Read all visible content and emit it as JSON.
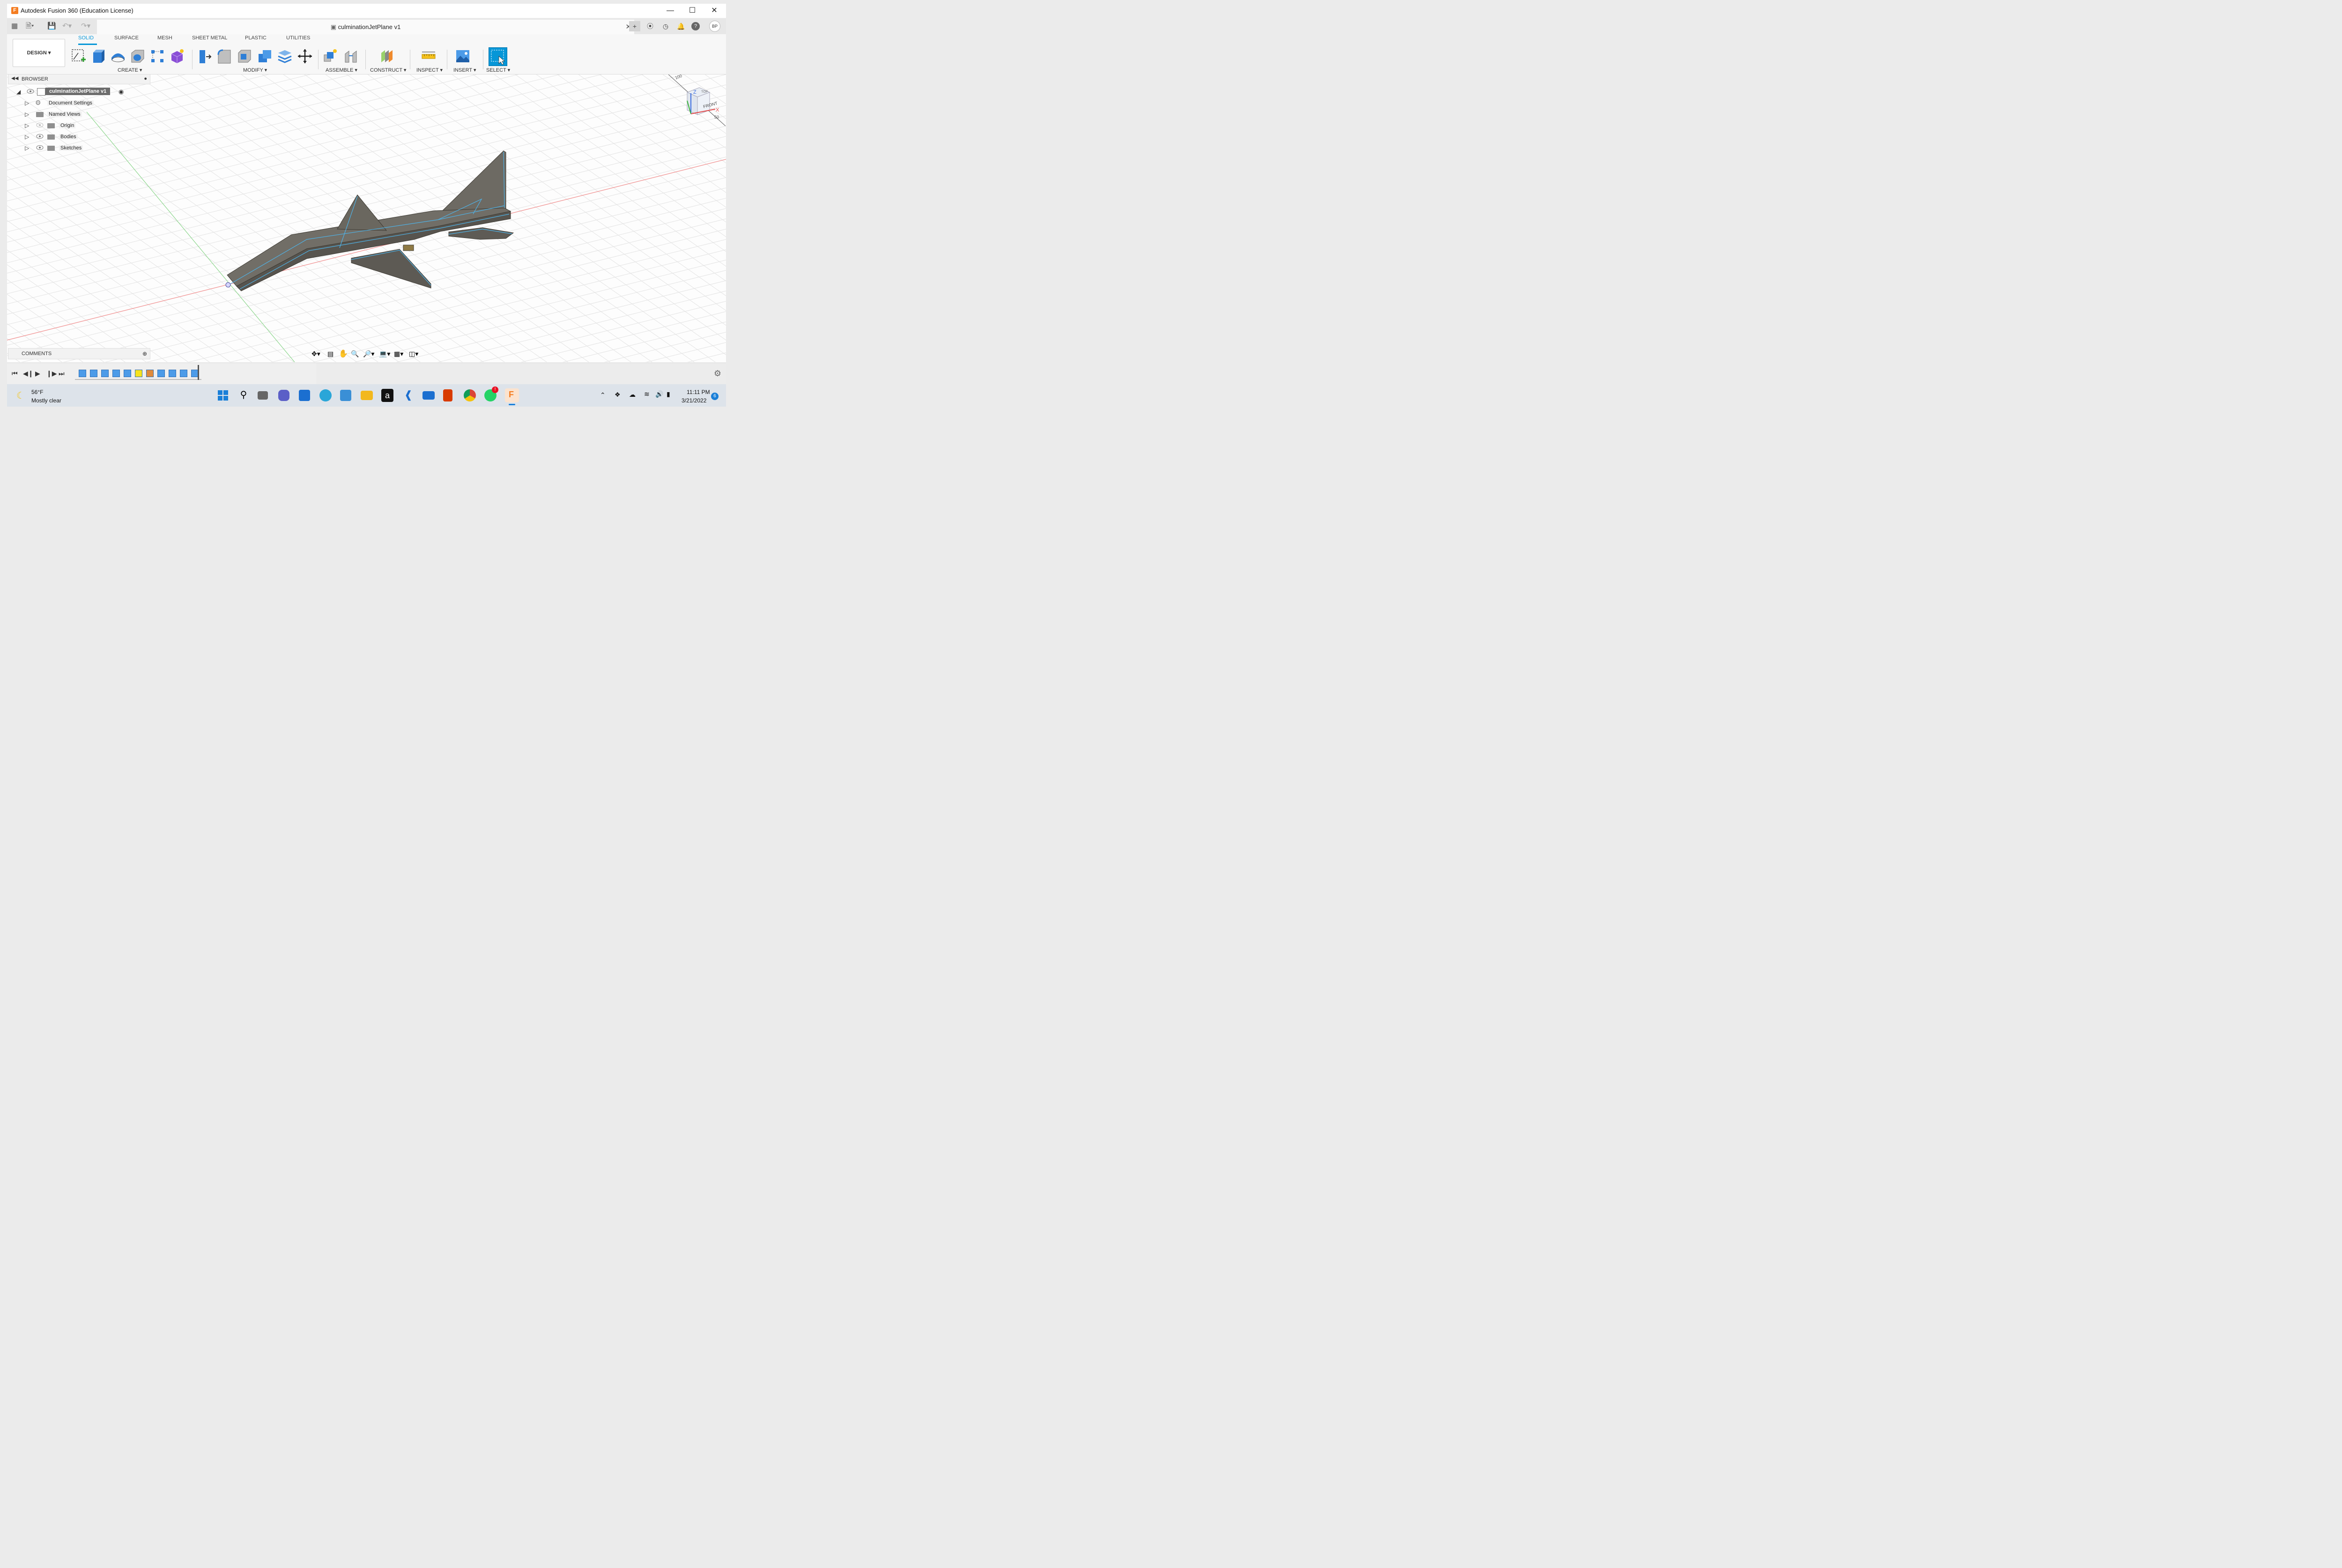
{
  "window": {
    "title": "Autodesk Fusion 360 (Education License)",
    "app_icon_letter": "F",
    "controls": [
      "minimize-icon",
      "maximize-icon",
      "close-icon"
    ]
  },
  "tabbar": {
    "document_title": "culminationJetPlane v1",
    "avatar_initials": "BP"
  },
  "ribbon": {
    "workspace_button": "DESIGN ▾",
    "tabs": [
      "SOLID",
      "SURFACE",
      "MESH",
      "SHEET METAL",
      "PLASTIC",
      "UTILITIES"
    ],
    "active_tab": "SOLID",
    "groups": [
      "CREATE ▾",
      "MODIFY ▾",
      "ASSEMBLE ▾",
      "CONSTRUCT ▾",
      "INSPECT ▾",
      "INSERT ▾",
      "SELECT ▾"
    ],
    "accent_color": "#0696d7"
  },
  "browser": {
    "title": "BROWSER",
    "root": "culminationJetPlane v1",
    "items": [
      {
        "label": "Document Settings",
        "icon": "gear-icon"
      },
      {
        "label": "Named Views",
        "icon": "folder-icon"
      },
      {
        "label": "Origin",
        "icon": "folder-icon",
        "hidden": true
      },
      {
        "label": "Bodies",
        "icon": "folder-icon"
      },
      {
        "label": "Sketches",
        "icon": "folder-icon"
      }
    ]
  },
  "viewcube": {
    "front_label": "FRONT",
    "top_label": "TOP",
    "axis_x": "X",
    "axis_z": "Z",
    "tick_100": "100",
    "tick_50": "50"
  },
  "comments": {
    "title": "COMMENTS"
  },
  "taskbar": {
    "weather_temp": "56°F",
    "weather_desc": "Mostly clear",
    "time": "11:11 PM",
    "date": "3/21/2022",
    "notification_count": "6",
    "whatsapp_badge": "!"
  }
}
